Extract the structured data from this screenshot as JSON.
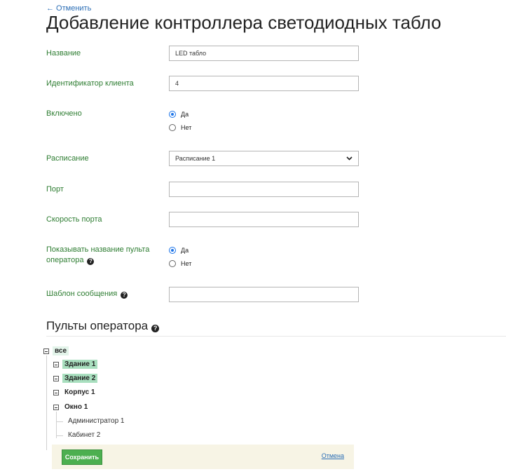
{
  "nav": {
    "back_label": "← Отменить"
  },
  "page": {
    "title": "Добавление контроллера светодиодных табло"
  },
  "form": {
    "name": {
      "label": "Название",
      "value": "LED табло"
    },
    "client_id": {
      "label": "Идентификатор клиента",
      "value": "4"
    },
    "enabled": {
      "label": "Включено",
      "options": [
        "Да",
        "Нет"
      ],
      "selected": "Да"
    },
    "schedule": {
      "label": "Расписание",
      "value": "Расписание 1"
    },
    "port": {
      "label": "Порт",
      "value": ""
    },
    "port_speed": {
      "label": "Скорость порта",
      "value": ""
    },
    "show_operator": {
      "label": "Показывать название пульта оператора",
      "options": [
        "Да",
        "Нет"
      ],
      "selected": "Да"
    },
    "message_template": {
      "label": "Шаблон сообщения",
      "value": ""
    }
  },
  "section": {
    "title": "Пульты оператора"
  },
  "tree": {
    "root": "все",
    "nodes": [
      "Здание 1",
      "Здание 2",
      "Корпус 1",
      "Окно 1"
    ],
    "leaves": [
      "Администратор 1",
      "Кабинет 2"
    ]
  },
  "footer": {
    "save_label": "Сохранить",
    "cancel_label": "Отмена"
  },
  "colors": {
    "label": "#2e7d32",
    "link": "#2a6db5",
    "save_button": "#4caf50",
    "highlight": "#a9dfbf",
    "footer_bg": "#f7f4e5"
  },
  "icons": {
    "help": "question-circle-icon",
    "tree_toggle": "minus-square-icon",
    "select_arrow": "chevron-down-icon"
  }
}
